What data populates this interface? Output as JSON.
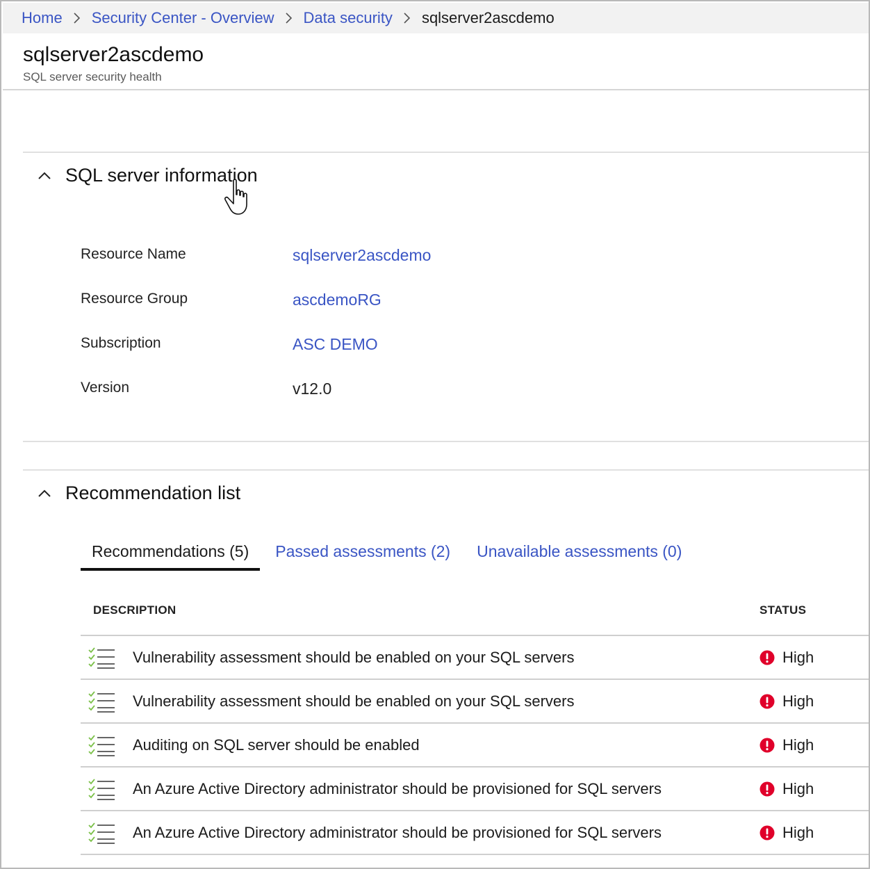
{
  "breadcrumb": {
    "items": [
      {
        "label": "Home"
      },
      {
        "label": "Security Center - Overview"
      },
      {
        "label": "Data security"
      }
    ],
    "current": "sqlserver2ascdemo"
  },
  "header": {
    "title": "sqlserver2ascdemo",
    "subtitle": "SQL server security health"
  },
  "server_info": {
    "title": "SQL server information",
    "fields": [
      {
        "label": "Resource Name",
        "value": "sqlserver2ascdemo"
      },
      {
        "label": "Resource Group",
        "value": "ascdemoRG"
      },
      {
        "label": "Subscription",
        "value": "ASC DEMO"
      },
      {
        "label": "Version",
        "value": "v12.0"
      }
    ]
  },
  "recommendations": {
    "title": "Recommendation list",
    "tabs": [
      {
        "label": "Recommendations (5)"
      },
      {
        "label": "Passed assessments (2)"
      },
      {
        "label": "Unavailable assessments (0)"
      }
    ],
    "columns": {
      "description": "DESCRIPTION",
      "status": "STATUS"
    },
    "rows": [
      {
        "description": "Vulnerability assessment should be enabled on your SQL servers",
        "status": "High"
      },
      {
        "description": "Vulnerability assessment should be enabled on your SQL servers",
        "status": "High"
      },
      {
        "description": "Auditing on SQL server should be enabled",
        "status": "High"
      },
      {
        "description": "An Azure Active Directory administrator should be provisioned for SQL servers",
        "status": "High"
      },
      {
        "description": "An Azure Active Directory administrator should be provisioned for SQL servers",
        "status": "High"
      }
    ]
  },
  "colors": {
    "link": "#3a55c4",
    "high_severity": "#e0002a",
    "check_green": "#7cc14a"
  }
}
